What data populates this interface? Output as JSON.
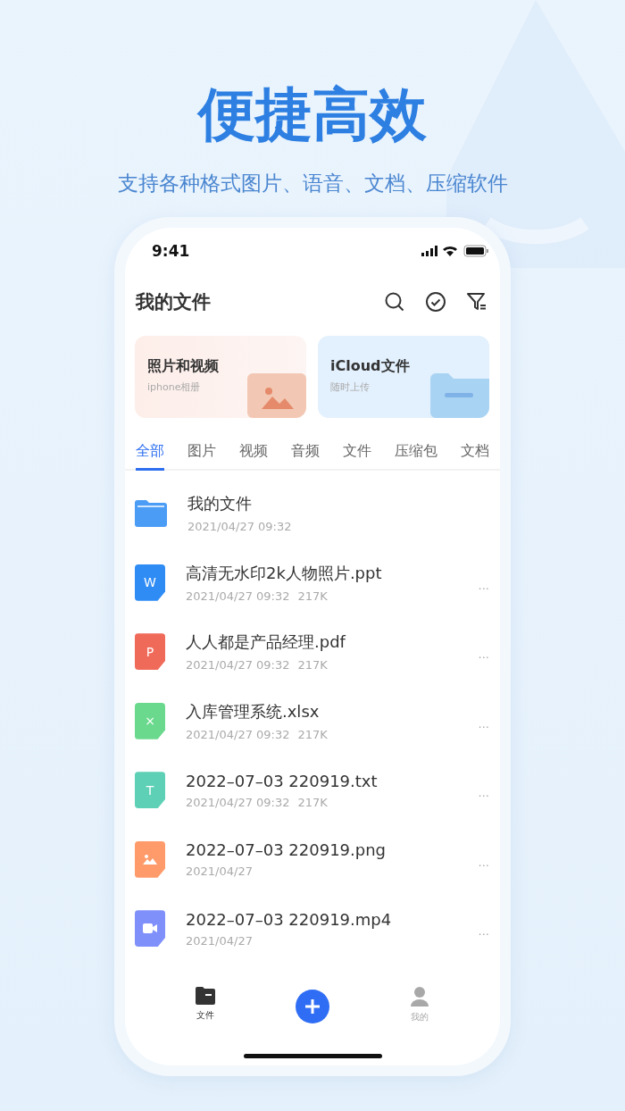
{
  "headline": "便捷高效",
  "subtitle": "支持各种格式图片、语音、文档、压缩软件",
  "status_bar": {
    "time": "9:41"
  },
  "header": {
    "title": "我的文件"
  },
  "cards": [
    {
      "kind": "photos",
      "title": "照片和视频",
      "subtitle": "iphone相册"
    },
    {
      "kind": "cloud",
      "title": "iCloud文件",
      "subtitle": "随时上传"
    }
  ],
  "tabs": [
    {
      "label": "全部",
      "selected": true
    },
    {
      "label": "图片",
      "selected": false
    },
    {
      "label": "视频",
      "selected": false
    },
    {
      "label": "音频",
      "selected": false
    },
    {
      "label": "文件",
      "selected": false
    },
    {
      "label": "压缩包",
      "selected": false
    },
    {
      "label": "文档",
      "selected": false
    }
  ],
  "files": [
    {
      "kind": "folder",
      "name": "我的文件",
      "date": "2021/04/27 09:32",
      "color": "#4a9cf5"
    },
    {
      "kind": "letter",
      "mark": "W",
      "name": "高清无水印2k人物照片.ppt",
      "date": "2021/04/27 09:32",
      "size": "217K",
      "color": "#2f8cf5",
      "more": "···"
    },
    {
      "kind": "letter",
      "mark": "P",
      "name": "人人都是产品经理.pdf",
      "date": "2021/04/27 09:32",
      "size": "217K",
      "color": "#f06a5a",
      "more": "···"
    },
    {
      "kind": "letter",
      "mark": "×",
      "name": "入库管理系统.xlsx",
      "date": "2021/04/27 09:32",
      "size": "217K",
      "color": "#6ad98d",
      "more": "···"
    },
    {
      "kind": "letter",
      "mark": "T",
      "name": "2022–07–03 220919.txt",
      "date": "2021/04/27 09:32",
      "size": "217K",
      "color": "#5dd0b5",
      "more": "···"
    },
    {
      "kind": "image",
      "name": "2022–07–03 220919.png",
      "date": "2021/04/27",
      "color": "#ff9a6a",
      "more": "···"
    },
    {
      "kind": "video",
      "name": "2022–07–03 220919.mp4",
      "date": "2021/04/27",
      "color": "#7f90fa",
      "more": "···"
    }
  ],
  "bottom_nav": [
    {
      "kind": "files",
      "label": "文件",
      "selected": true
    },
    {
      "kind": "add"
    },
    {
      "kind": "me",
      "label": "我的",
      "selected": false
    }
  ]
}
